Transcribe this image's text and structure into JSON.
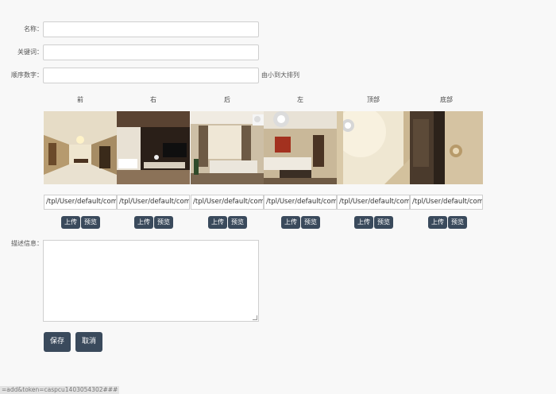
{
  "form": {
    "name_label": "名称：",
    "name_value": "",
    "keyword_label": "关键词：",
    "keyword_value": "",
    "order_label": "顺序数字：",
    "order_value": "",
    "order_hint": "由小到大排列",
    "desc_label": "描述信息：",
    "desc_value": ""
  },
  "faces": [
    {
      "label": "前",
      "path": "/tpl/User/default/common/"
    },
    {
      "label": "右",
      "path": "/tpl/User/default/common/"
    },
    {
      "label": "后",
      "path": "/tpl/User/default/common/"
    },
    {
      "label": "左",
      "path": "/tpl/User/default/common/"
    },
    {
      "label": "顶部",
      "path": "/tpl/User/default/common/"
    },
    {
      "label": "底部",
      "path": "/tpl/User/default/common/"
    }
  ],
  "buttons": {
    "upload": "上传",
    "preview": "预览",
    "save": "保存",
    "cancel": "取消"
  },
  "status_bar": "=add&token=caspcu1403054302###"
}
